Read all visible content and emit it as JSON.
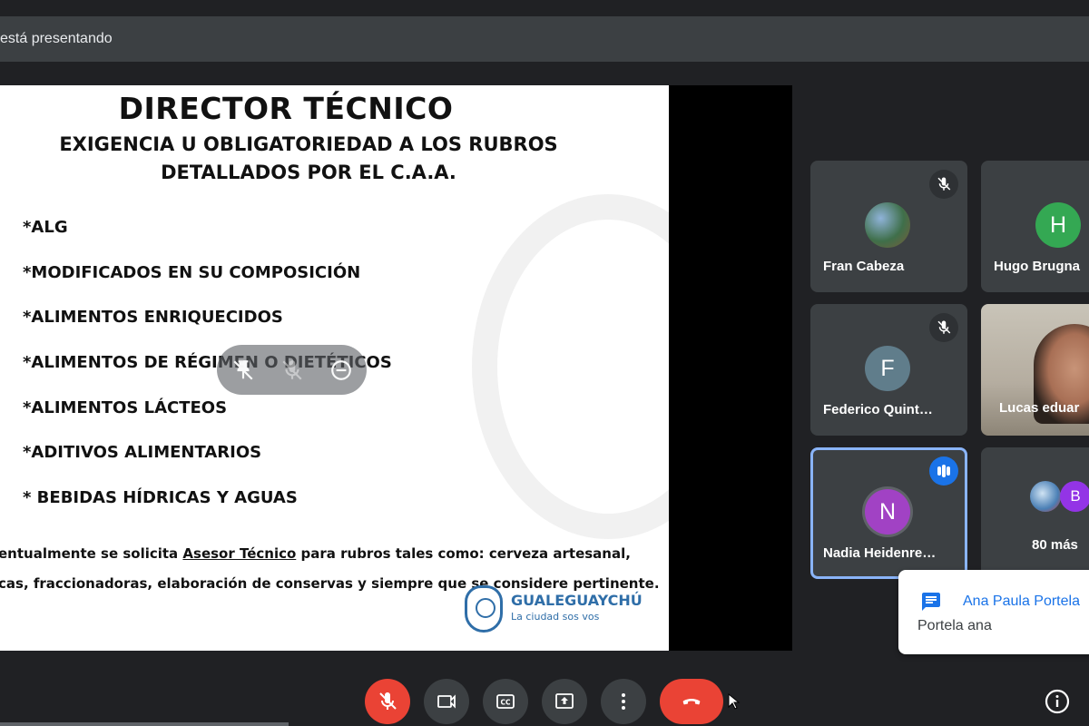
{
  "topbar": {
    "presenting_text": "está presentando"
  },
  "slide": {
    "title": "DIRECTOR TÉCNICO",
    "subtitle_line1": "EXIGENCIA U OBLIGATORIEDAD A LOS RUBROS",
    "subtitle_line2": "DETALLADOS POR EL C.A.A.",
    "bullets": [
      "*ALG",
      "*MODIFICADOS EN SU COMPOSICIÓN",
      "*ALIMENTOS ENRIQUECIDOS",
      "*ALIMENTOS DE RÉGIMEN O DIETÉTICOS",
      "*ALIMENTOS LÁCTEOS",
      "*ADITIVOS ALIMENTARIOS",
      "* BEBIDAS HÍDRICAS Y AGUAS"
    ],
    "note_line1_prefix": "entualmente se solicita ",
    "note_line1_link": "Asesor Técnico",
    "note_line1_suffix": " para rubros tales como: cerveza artesanal,",
    "note_line2": "cas, fraccionadoras, elaboración de conservas y siempre que se considere pertinente.",
    "logo_name": "GUALEGUAYCHÚ",
    "logo_tagline": "La ciudad sos vos"
  },
  "overlay_icons": [
    "pin-off-icon",
    "mute-off-icon",
    "remove-icon"
  ],
  "participants": [
    {
      "name": "Fran Cabeza",
      "avatar": "photo",
      "muted": true
    },
    {
      "name": "Hugo Brugna",
      "initial": "H",
      "avatar_color": "#34a853",
      "muted": false
    },
    {
      "name": "Federico Quint…",
      "initial": "F",
      "avatar_color": "#607d8b",
      "muted": true
    },
    {
      "name": "Lucas eduar",
      "avatar": "video",
      "muted": false
    },
    {
      "name": "Nadia Heidenre…",
      "initial": "N",
      "avatar_color": "#a142c4",
      "speaking": true
    },
    {
      "name": "80 más",
      "initial": "B",
      "avatar_color": "#9334e6"
    }
  ],
  "notification": {
    "sender": "Ana Paula Portela",
    "message": "Portela ana"
  },
  "controls": {
    "mic": "mic-off-icon",
    "camera": "camera-icon",
    "captions": "captions-icon",
    "present": "present-icon",
    "more": "more-vert-icon",
    "hangup": "hangup-icon",
    "info": "info-icon"
  },
  "colors": {
    "background": "#202124",
    "tile": "#3c4043",
    "accent": "#1a73e8",
    "danger": "#ea4335",
    "highlight": "#8ab4f8"
  }
}
